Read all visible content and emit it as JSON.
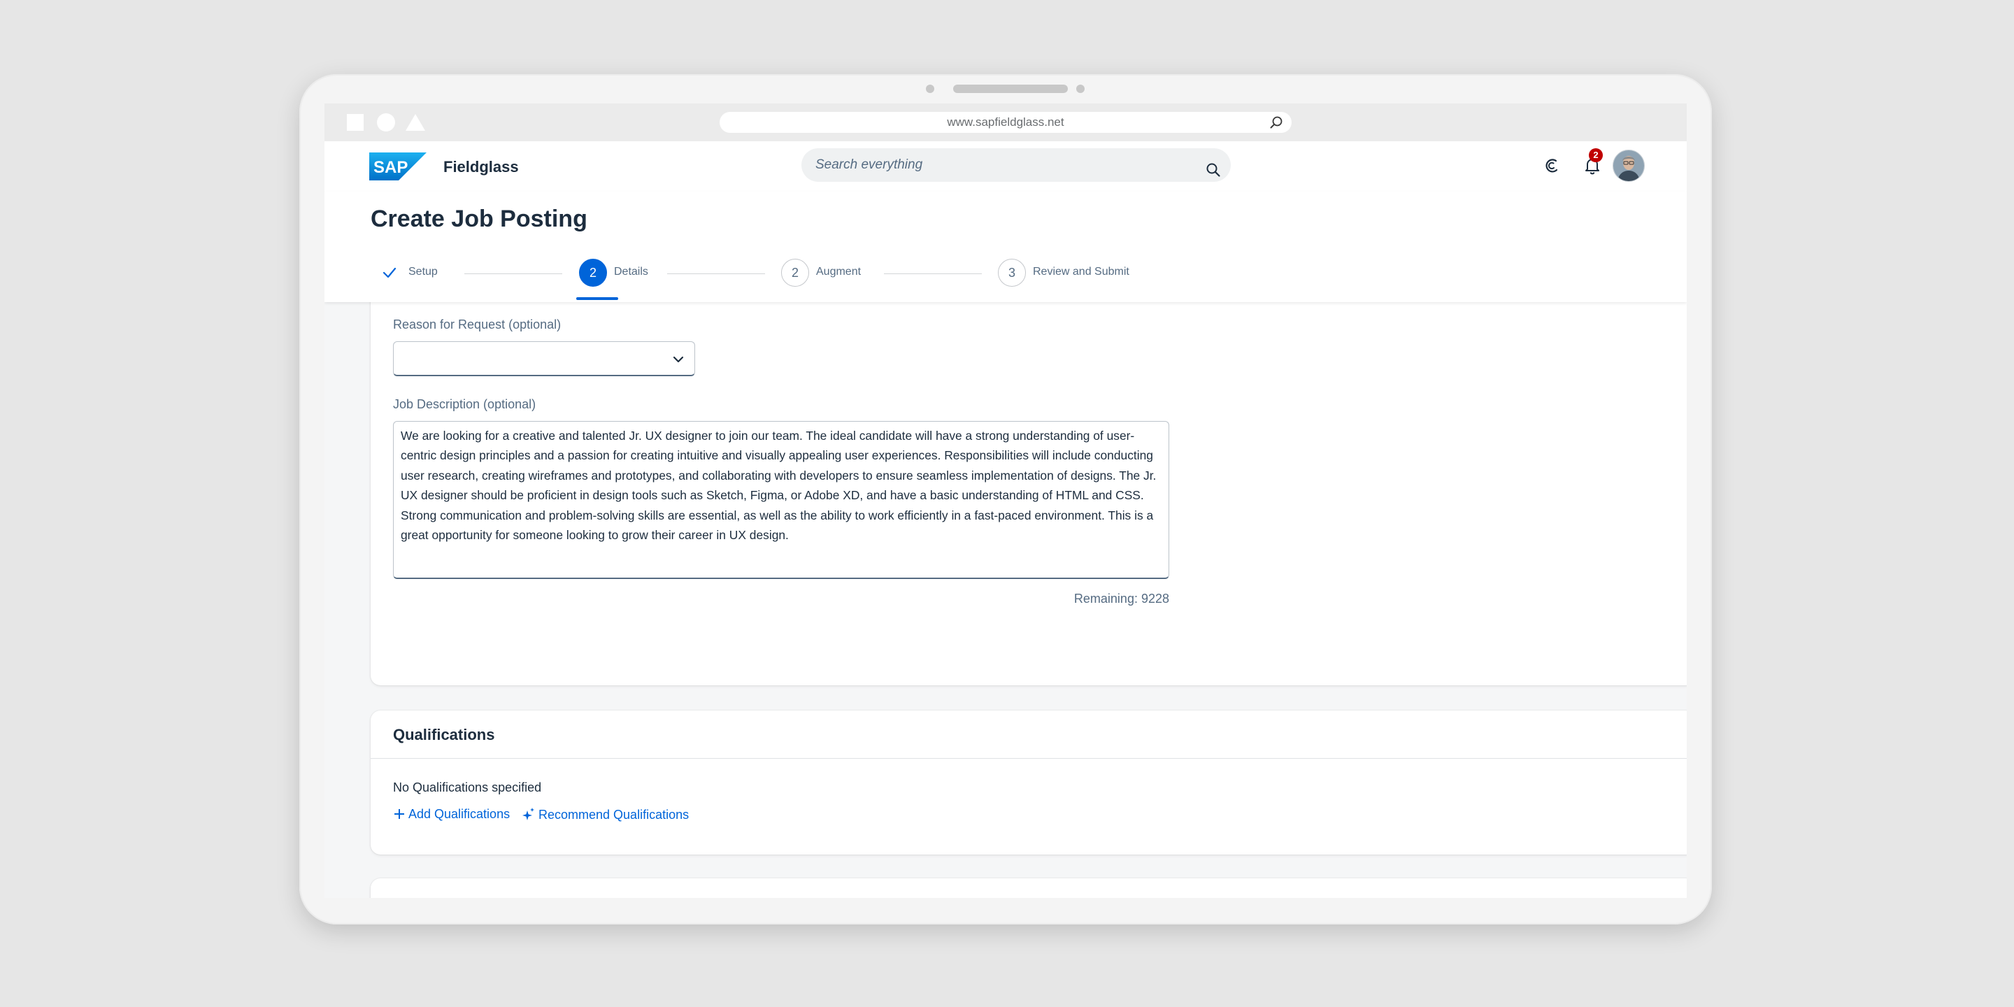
{
  "browser": {
    "url": "www.sapfieldglass.net"
  },
  "shell": {
    "logo_text": "SAP",
    "product": "Fieldglass",
    "search_placeholder": "Search everything",
    "notification_count": "2",
    "icons": [
      "joule-icon",
      "bell-icon",
      "avatar"
    ]
  },
  "page": {
    "title": "Create Job Posting"
  },
  "wizard": {
    "steps": [
      {
        "marker": "check-icon",
        "label": "Setup",
        "status": "completed"
      },
      {
        "number": "2",
        "label": "Details",
        "status": "active"
      },
      {
        "number": "2",
        "label": "Augment",
        "status": "pending"
      },
      {
        "number": "3",
        "label": "Review and Submit",
        "status": "pending"
      }
    ]
  },
  "details": {
    "reason_label": "Reason for Request (optional)",
    "reason_value": "",
    "description_label": "Job Description (optional)",
    "description_value": "We are looking for a creative and talented Jr. UX designer to join our team. The ideal candidate will have a strong understanding of user-centric design principles and a passion for creating intuitive and visually appealing user experiences. Responsibilities will include conducting user research, creating wireframes and prototypes, and collaborating with developers to ensure seamless implementation of designs. The Jr. UX designer should be proficient in design tools such as Sketch, Figma, or Adobe XD, and have a basic understanding of HTML and CSS. Strong communication and problem-solving skills are essential, as well as the ability to work efficiently in a fast-paced environment. This is a great opportunity for someone looking to grow their career in UX design.",
    "remaining": "Remaining: 9228"
  },
  "qualifications": {
    "title": "Qualifications",
    "empty_text": "No Qualifications specified",
    "add_link": "Add Qualifications",
    "recommend_link": "Recommend Qualifications"
  },
  "colors": {
    "brand_blue": "#0064d9",
    "text_dark": "#1d2d3e",
    "text_muted": "#556b82",
    "badge_red": "#c00000"
  }
}
